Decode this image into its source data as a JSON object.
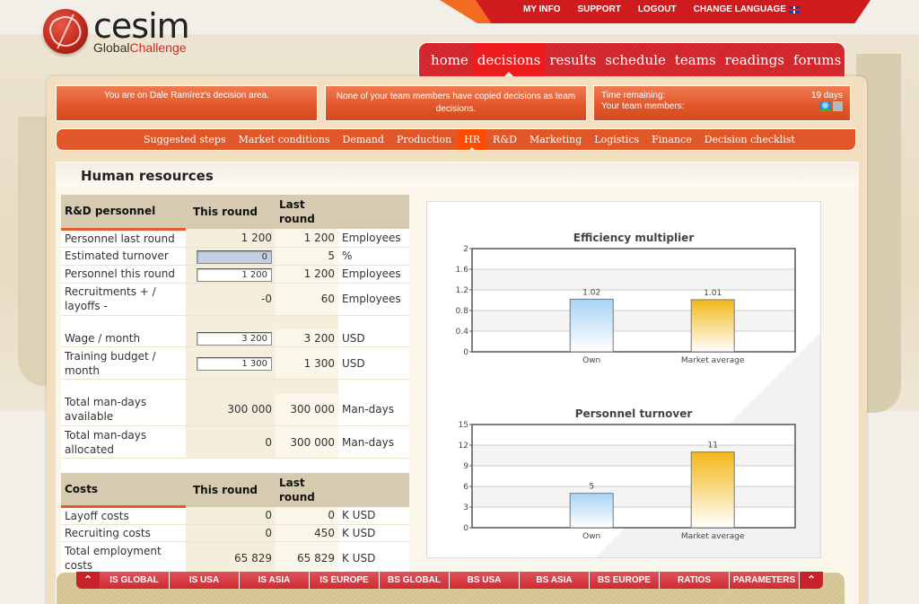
{
  "brand": {
    "name": "cesim",
    "sub_prefix": "Global",
    "sub_suffix": "Challenge"
  },
  "top_links": [
    "MY INFO",
    "SUPPORT",
    "LOGOUT",
    "CHANGE LANGUAGE"
  ],
  "main_nav": {
    "items": [
      "home",
      "decisions",
      "results",
      "schedule",
      "teams",
      "readings",
      "forums"
    ],
    "active": "decisions"
  },
  "info": {
    "decision_area": "You are on Dale Ramírez's decision area.",
    "copy_status": "None of your team members have copied decisions as team decisions.",
    "time_label": "Time remaining:",
    "time_value": "19 days",
    "members_label": "Your team members:"
  },
  "sub_nav": {
    "items": [
      "Suggested steps",
      "Market conditions",
      "Demand",
      "Production",
      "HR",
      "R&D",
      "Marketing",
      "Logistics",
      "Finance",
      "Decision checklist"
    ],
    "active": "HR"
  },
  "page_title": "Human resources",
  "personnel_table": {
    "headers": [
      "R&D personnel",
      "This round",
      "Last round",
      ""
    ],
    "rows": [
      {
        "label": "Personnel last round",
        "this": "1 200",
        "last": "1 200",
        "unit": "Employees",
        "input": false
      },
      {
        "label": "Estimated turnover",
        "this": "0",
        "last": "5",
        "unit": "%",
        "input": true,
        "highlight": true
      },
      {
        "label": "Personnel this round",
        "this": "1 200",
        "last": "1 200",
        "unit": "Employees",
        "input": true
      },
      {
        "label": "Recruitments + / layoffs -",
        "this": "-0",
        "last": "60",
        "unit": "Employees",
        "input": false
      },
      {
        "label": "Wage / month",
        "this": "3 200",
        "last": "3 200",
        "unit": "USD",
        "input": true
      },
      {
        "label": "Training budget / month",
        "this": "1 300",
        "last": "1 300",
        "unit": "USD",
        "input": true
      },
      {
        "label": "Total man-days available",
        "this": "300 000",
        "last": "300 000",
        "unit": "Man-days",
        "input": false
      },
      {
        "label": "Total man-days allocated",
        "this": "0",
        "last": "300 000",
        "unit": "Man-days",
        "input": false
      }
    ]
  },
  "costs_table": {
    "headers": [
      "Costs",
      "This round",
      "Last round",
      ""
    ],
    "rows": [
      {
        "label": "Layoff costs",
        "this": "0",
        "last": "0",
        "unit": "K USD"
      },
      {
        "label": "Recruiting costs",
        "this": "0",
        "last": "450",
        "unit": "K USD"
      },
      {
        "label": "Total employment costs",
        "this": "65 829",
        "last": "65 829",
        "unit": "K USD"
      }
    ]
  },
  "chart_data": [
    {
      "type": "bar",
      "title": "Efficiency multiplier",
      "categories": [
        "Own",
        "Market average"
      ],
      "values": [
        1.02,
        1.01
      ],
      "value_labels": [
        "1.02",
        "1.01"
      ],
      "yticks": [
        "0",
        "0.4",
        "0.8",
        "1.2",
        "1.6",
        "2"
      ],
      "ylim": [
        0,
        2
      ],
      "grid": true,
      "colors": [
        "#a9d4f5",
        "#f2b817"
      ]
    },
    {
      "type": "bar",
      "title": "Personnel turnover",
      "categories": [
        "Own",
        "Market average"
      ],
      "values": [
        5,
        11
      ],
      "value_labels": [
        "5",
        "11"
      ],
      "yticks": [
        "0",
        "3",
        "6",
        "9",
        "12",
        "15"
      ],
      "ylim": [
        0,
        15
      ],
      "grid": true,
      "colors": [
        "#a9d4f5",
        "#f2b817"
      ]
    }
  ],
  "report_tabs": [
    "IS GLOBAL",
    "IS USA",
    "IS ASIA",
    "IS EUROPE",
    "BS GLOBAL",
    "BS USA",
    "BS ASIA",
    "BS EUROPE",
    "RATIOS",
    "PARAMETERS"
  ],
  "colors": {
    "brand_red": "#cf1b1d",
    "nav_orange": "#e25a2c",
    "active_orange": "#ff4b00"
  }
}
